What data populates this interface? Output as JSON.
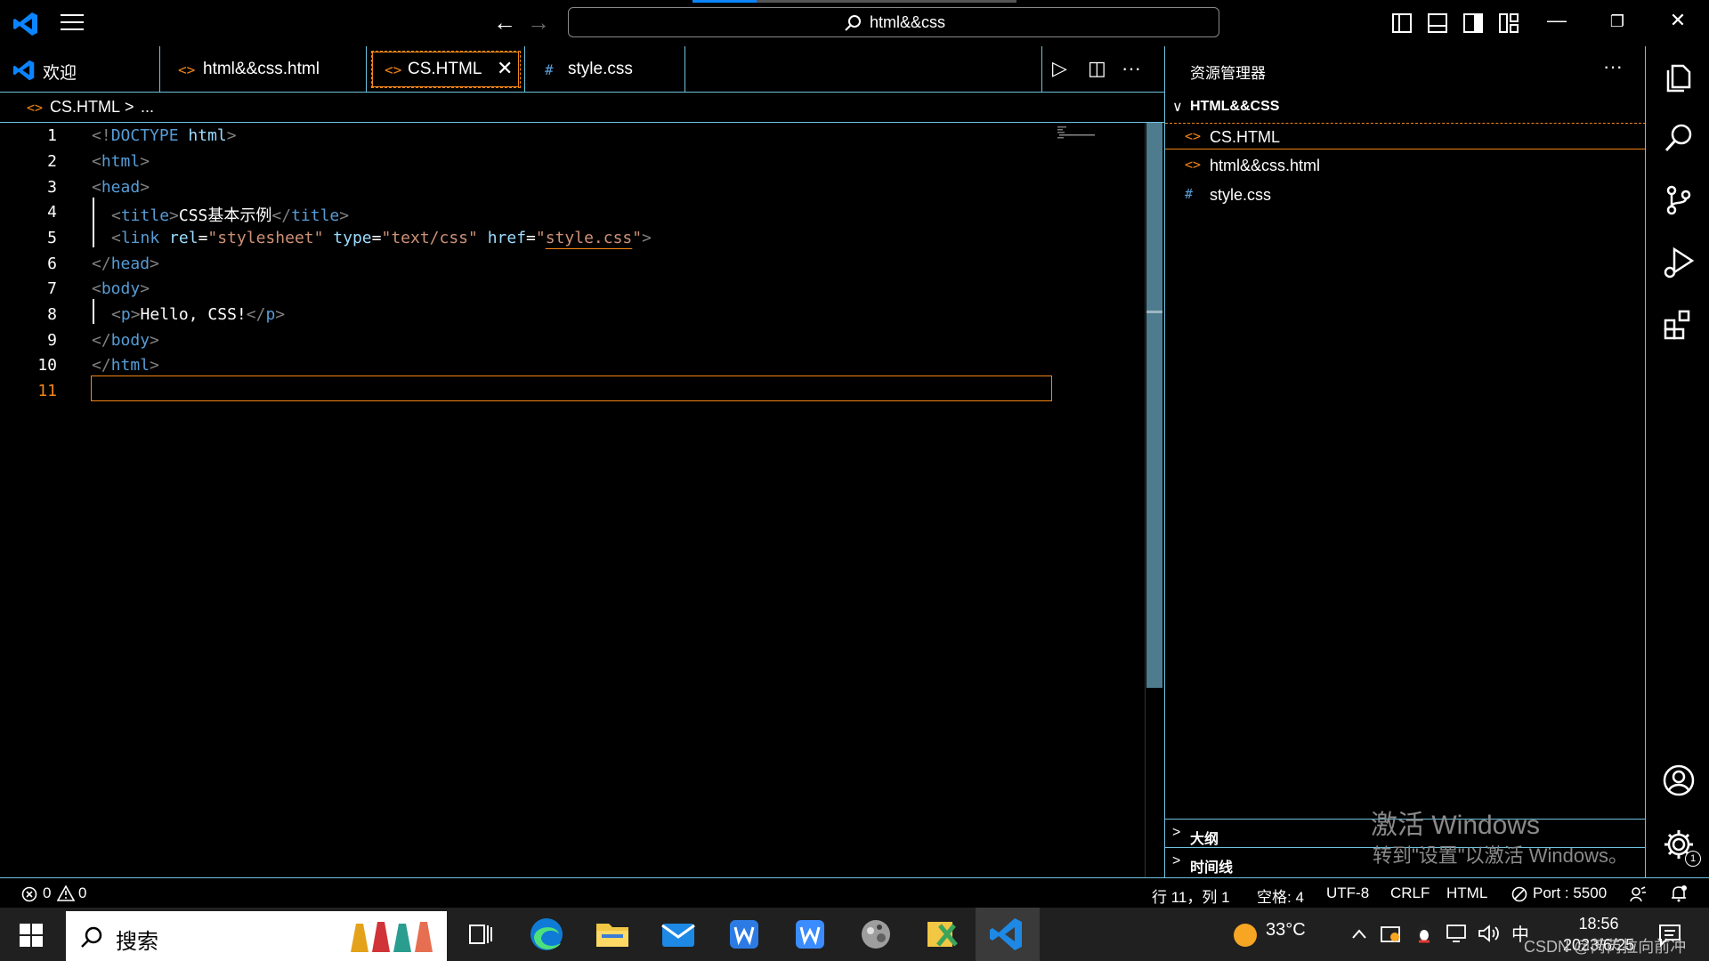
{
  "title_bar": {
    "search_text": "html&&css",
    "minimize_glyph": "—",
    "restore_glyph": "❐",
    "close_glyph": "✕",
    "back_glyph": "←",
    "forward_glyph": "→"
  },
  "tabs": [
    {
      "label": "欢迎",
      "icon": "vscode-logo-icon"
    },
    {
      "label": "html&&css.html",
      "icon": "html-file-icon",
      "glyph": "<>"
    },
    {
      "label": "CS.HTML",
      "icon": "html-file-icon",
      "glyph": "<>",
      "active": true,
      "close_glyph": "✕"
    },
    {
      "label": "style.css",
      "icon": "css-file-icon",
      "glyph": "#"
    }
  ],
  "tab_actions": {
    "run_glyph": "▷",
    "split_glyph": "◫",
    "more_glyph": "···"
  },
  "breadcrumb": {
    "file": "CS.HTML",
    "separator": ">",
    "rest": "..."
  },
  "editor": {
    "line_numbers": [
      "1",
      "2",
      "3",
      "4",
      "5",
      "6",
      "7",
      "8",
      "9",
      "10",
      "11"
    ],
    "current_line": "11",
    "lines": {
      "l1": {
        "p1": "<!",
        "tag": "DOCTYPE",
        "sp": " ",
        "attr": "html",
        "p2": ">"
      },
      "l2": {
        "p1": "<",
        "tag": "html",
        "p2": ">"
      },
      "l3": {
        "p1": "<",
        "tag": "head",
        "p2": ">"
      },
      "l4": {
        "p1": "<",
        "tag": "title",
        "p2": ">",
        "text": "CSS基本示例",
        "p3": "</",
        "tag2": "title",
        "p4": ">"
      },
      "l5": {
        "p1": "<",
        "tag": "link",
        "a1": " rel",
        "eq1": "=",
        "v1": "\"stylesheet\"",
        "a2": " type",
        "eq2": "=",
        "v2": "\"text/css\"",
        "a3": " href",
        "eq3": "=",
        "q1": "\"",
        "v3": "style.css",
        "q2": "\"",
        "p2": ">"
      },
      "l6": {
        "p1": "</",
        "tag": "head",
        "p2": ">"
      },
      "l7": {
        "p1": "<",
        "tag": "body",
        "p2": ">"
      },
      "l8": {
        "p1": "<",
        "tag": "p",
        "p2": ">",
        "text": "Hello, CSS!",
        "p3": "</",
        "tag2": "p",
        "p4": ">"
      },
      "l9": {
        "p1": "</",
        "tag": "body",
        "p2": ">"
      },
      "l10": {
        "p1": "</",
        "tag": "html",
        "p2": ">"
      }
    }
  },
  "explorer": {
    "title": "资源管理器",
    "more_glyph": "···",
    "folder": "HTML&&CSS",
    "files": [
      {
        "name": "CS.HTML",
        "glyph": "<>",
        "selected": true
      },
      {
        "name": "html&&css.html",
        "glyph": "<>"
      },
      {
        "name": "style.css",
        "glyph": "#"
      }
    ],
    "outline_label": "大纲",
    "timeline_label": "时间线",
    "chevron_right": ">",
    "chevron_down": "∨"
  },
  "watermark": {
    "line1": "激活 Windows",
    "line2": "转到\"设置\"以激活 Windows。"
  },
  "activity_bar": {
    "settings_badge": "1"
  },
  "status_bar": {
    "errors": "0",
    "warnings": "0",
    "position": "行 11，列 1",
    "spaces": "空格: 4",
    "encoding": "UTF-8",
    "eol": "CRLF",
    "language": "HTML",
    "port": "Port : 5500"
  },
  "taskbar": {
    "search_placeholder": "搜索",
    "weather_temp": "33°C",
    "ime": "中",
    "time": "18:56",
    "date": "2023/6/25",
    "csdn_watermark": "CSDN @芮芮拉向前冲"
  },
  "colors": {
    "accent_border": "#6fc3df",
    "focus_orange": "#f38518",
    "tag_blue": "#569cd6",
    "attr_lightblue": "#9cdcfe",
    "string_orange": "#ce9178"
  }
}
